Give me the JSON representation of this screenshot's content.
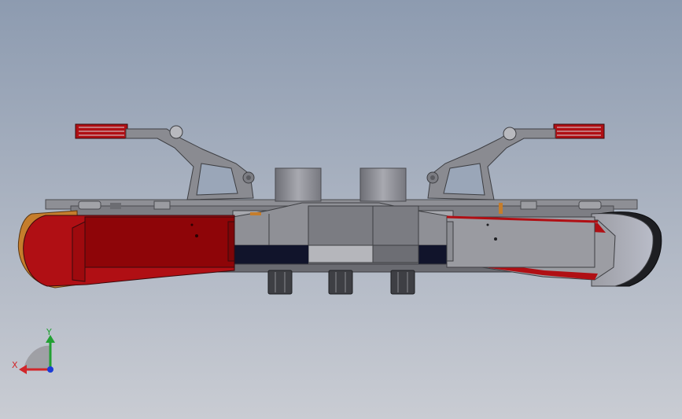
{
  "viewport": {
    "background_top": "#8d9bb0",
    "background_bottom": "#c9ccd3"
  },
  "model": {
    "icon": "cad-assembly-model",
    "colors": {
      "red": "#b00f14",
      "dark_red": "#7e0508",
      "orange": "#c57d2c",
      "steel": "#8c8c90",
      "steel_light": "#b4b5ba",
      "steel_dark": "#5a5b60",
      "navy": "#11142b",
      "black": "#1d1e22"
    }
  },
  "triad": {
    "x_label": "X",
    "y_label": "Y",
    "x_color": "#d1262a",
    "y_color": "#22a033",
    "z_color": "#1b3bd6"
  }
}
